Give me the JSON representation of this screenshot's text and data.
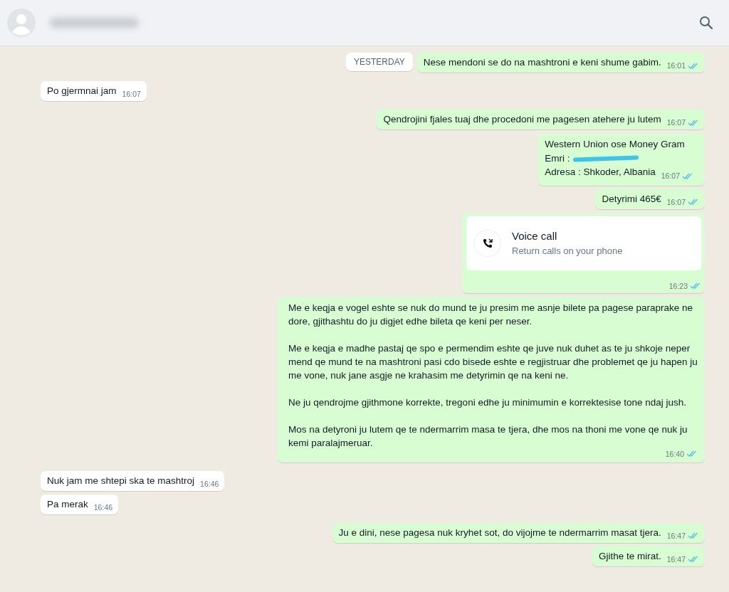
{
  "date_chip": "YESTERDAY",
  "messages": [
    {
      "kind": "text",
      "outgoing": true,
      "text": "Nese mendoni se do na mashtroni e keni shume gabim.",
      "time": "16:01",
      "read": true
    },
    {
      "kind": "text",
      "outgoing": false,
      "text": "Po gjermnai jam",
      "time": "16:07"
    },
    {
      "kind": "text",
      "outgoing": true,
      "text": "Qendrojini fjales tuaj dhe procedoni me pagesen atehere ju lutem",
      "time": "16:07",
      "read": true
    },
    {
      "kind": "lines",
      "outgoing": true,
      "lines": [
        {
          "text": "Western Union ose Money Gram",
          "redacted": false
        },
        {
          "text": "Emri :",
          "redacted": true
        },
        {
          "text": "Adresa : Shkoder, Albania",
          "redacted": false
        }
      ],
      "time": "16:07",
      "read": true
    },
    {
      "kind": "text",
      "outgoing": true,
      "text": "Detyrimi 465€",
      "time": "16:07",
      "read": true
    },
    {
      "kind": "call",
      "outgoing": true,
      "title": "Voice call",
      "subtitle": "Return calls on your phone",
      "time": "16:23",
      "read": true
    },
    {
      "kind": "paragraphs",
      "outgoing": true,
      "paragraphs": [
        "Me e keqja e vogel eshte se nuk do mund te ju presim me asnje bilete pa pagese paraprake ne dore, gjithashtu do ju digjet edhe bileta qe keni per neser.",
        "Me e keqja e madhe pastaj qe spo e permendim eshte qe juve nuk duhet as te ju shkoje neper mend qe mund te na mashtroni pasi cdo bisede eshte e regjistruar dhe problemet qe ju hapen ju me vone, nuk jane asgje ne krahasim me detyrimin qe na keni ne.",
        "Ne ju qendrojme gjithmone korrekte, tregoni edhe ju minimumin e korrektesise tone ndaj jush.",
        "Mos na detyroni ju lutem qe te ndermarrim masa te tjera, dhe mos na thoni me vone qe nuk ju kemi paralajmeruar."
      ],
      "time": "16:40",
      "read": true
    },
    {
      "kind": "text",
      "outgoing": false,
      "text": "Nuk jam me shtepi ska te mashtroj",
      "time": "16:46"
    },
    {
      "kind": "text",
      "outgoing": false,
      "text": "Pa merak",
      "time": "16:46"
    },
    {
      "kind": "text",
      "outgoing": true,
      "text": "Ju e dini, nese pagesa nuk kryhet sot, do vijojme te ndermarrim masat tjera.",
      "time": "16:47",
      "read": true
    },
    {
      "kind": "text",
      "outgoing": true,
      "text": "Gjithe te mirat.",
      "time": "16:47",
      "read": true
    }
  ]
}
